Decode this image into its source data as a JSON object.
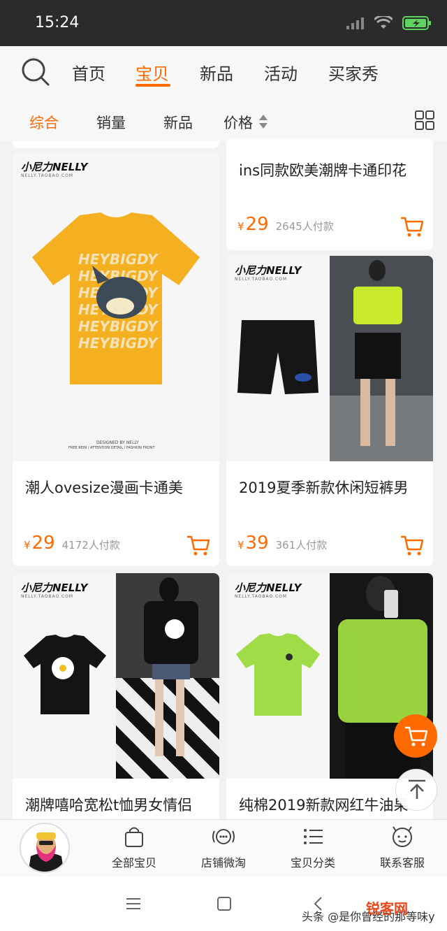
{
  "status": {
    "time": "15:24"
  },
  "nav": {
    "tabs": [
      "首页",
      "宝贝",
      "新品",
      "活动",
      "买家秀"
    ]
  },
  "sort": {
    "tabs": [
      "综合",
      "销量",
      "新品",
      "价格"
    ]
  },
  "brand": {
    "logo": "小尼力NELLY",
    "sub": "NELLY.TAOBAO.COM"
  },
  "print": {
    "shirt_text": [
      "HEYBIGDY",
      "HEYBIGDY",
      "HEYBIGDY",
      "HEYBIGDY",
      "HEYBIGDY",
      "HEYBIGDY"
    ],
    "tag": "DESIGNED BY NELLY",
    "tagline": "FREE REIN / ATTENTION DETAIL / FASHION FRONT"
  },
  "products": [
    {
      "title": "潮人ovesize漫画卡通美",
      "price": "29",
      "sold": "4172人付款"
    },
    {
      "title": "ins同款欧美潮牌卡通印花",
      "price": "29",
      "sold": "2645人付款"
    },
    {
      "title": "2019夏季新款休闲短裤男",
      "price": "39",
      "sold": "361人付款"
    },
    {
      "title": "潮牌嘻哈宽松t恤男女情侣",
      "price": "",
      "sold": ""
    },
    {
      "title": "纯棉2019新款网红牛油果",
      "price": "",
      "sold": ""
    }
  ],
  "currency": "¥",
  "bottom": {
    "items": [
      "全部宝贝",
      "店铺微淘",
      "宝贝分类",
      "联系客服"
    ]
  },
  "watermark": {
    "text": "头条 @是你曾经的那等味y",
    "logo": "锐客网"
  },
  "colors": {
    "accent": "#ff6a00",
    "status_bg": "#2b2b2b"
  }
}
